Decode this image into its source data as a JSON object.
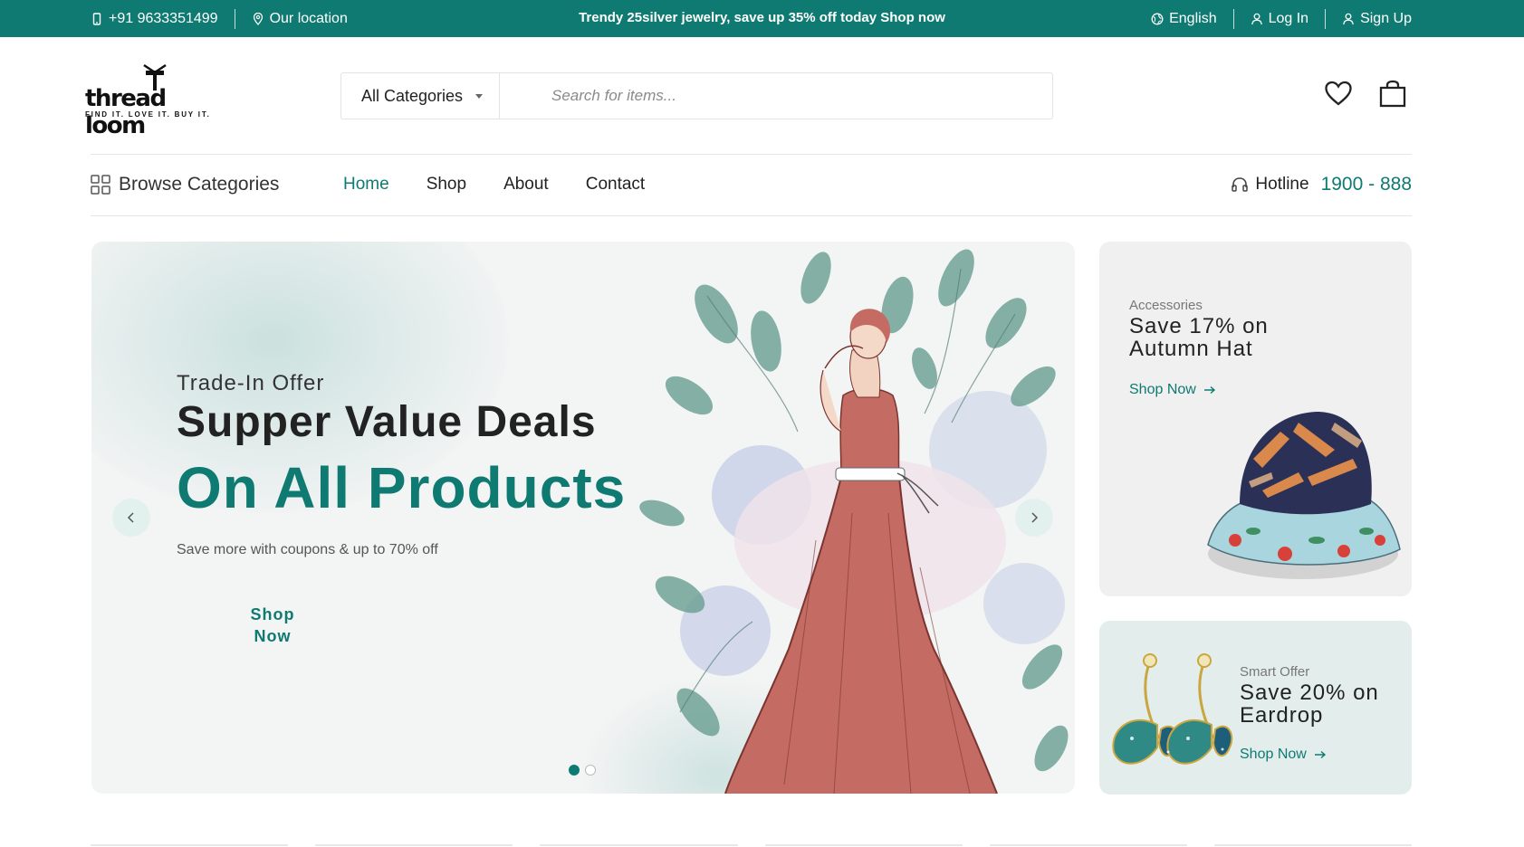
{
  "topbar": {
    "phone": "+91 9633351499",
    "location": "Our location",
    "promo": "Trendy 25silver jewelry, save up 35% off today Shop now",
    "language": "English",
    "login": "Log In",
    "signup": "Sign Up"
  },
  "logo": {
    "word": "thread loom",
    "tagline": "FIND IT. LOVE IT. BUY IT."
  },
  "search": {
    "category": "All Categories",
    "placeholder": "Search for items..."
  },
  "nav": {
    "browse": "Browse Categories",
    "items": [
      "Home",
      "Shop",
      "About",
      "Contact"
    ],
    "active": "Home",
    "hotline_label": "Hotline",
    "hotline_number": "1900 - 888"
  },
  "hero": {
    "subtitle": "Trade-In Offer",
    "title": "Supper Value Deals",
    "highlight": "On All Products",
    "description": "Save more with coupons & up to 70% off",
    "button": "Shop Now",
    "slides": 2,
    "active_slide": 1
  },
  "banners": [
    {
      "category": "Accessories",
      "title": "Save 17% on Autumn Hat",
      "link": "Shop Now"
    },
    {
      "category": "Smart Offer",
      "title": "Save 20% on Eardrop",
      "link": "Shop Now"
    }
  ],
  "colors": {
    "brand": "#0e7a72",
    "topbar_bg": "#0e7a72",
    "hero_bg": "#f3f4f4"
  },
  "icons": [
    "phone-icon",
    "location-icon",
    "globe-icon",
    "user-icon",
    "heart-icon",
    "bag-icon",
    "grid-icon",
    "headset-icon",
    "chevron-left-icon",
    "chevron-right-icon",
    "arrow-right-icon"
  ]
}
